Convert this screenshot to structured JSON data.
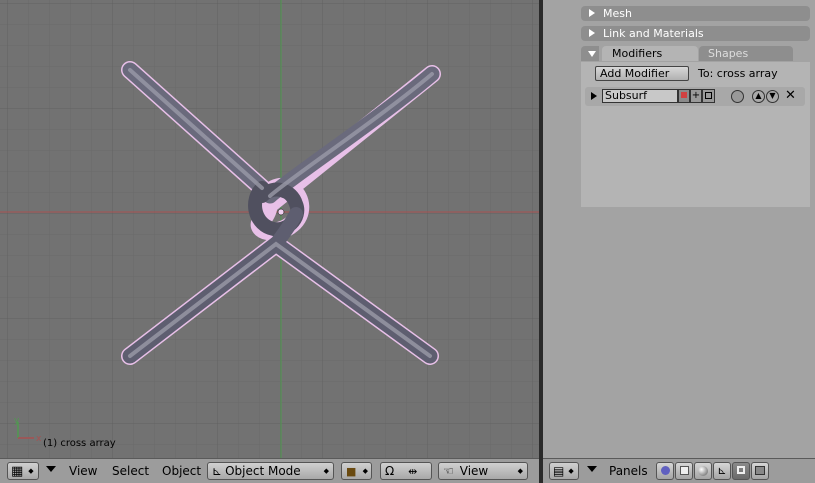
{
  "viewport": {
    "object_label": "(1) cross array",
    "axis_x": "x",
    "axis_y": "y"
  },
  "properties": {
    "panels": [
      {
        "label": "Mesh"
      },
      {
        "label": "Link and Materials"
      }
    ],
    "tabs": {
      "active": "Modifiers",
      "inactive": "Shapes"
    },
    "add_modifier_label": "Add Modifier",
    "target_label": "To: cross array",
    "modifier": {
      "name": "Subsurf",
      "close": "✕"
    }
  },
  "header_left": {
    "view_menu": "View",
    "select_menu": "Select",
    "object_menu": "Object",
    "mode": "Object Mode",
    "view_select": "View"
  },
  "header_right": {
    "panels_label": "Panels"
  },
  "colors": {
    "viewport_bg": "#727272",
    "grid": "#6a6a6a",
    "x_axis": "#a85050",
    "y_axis": "#4f9a4f",
    "panel_bg": "#a3a3a3",
    "header_bg": "#9c9c9c"
  }
}
